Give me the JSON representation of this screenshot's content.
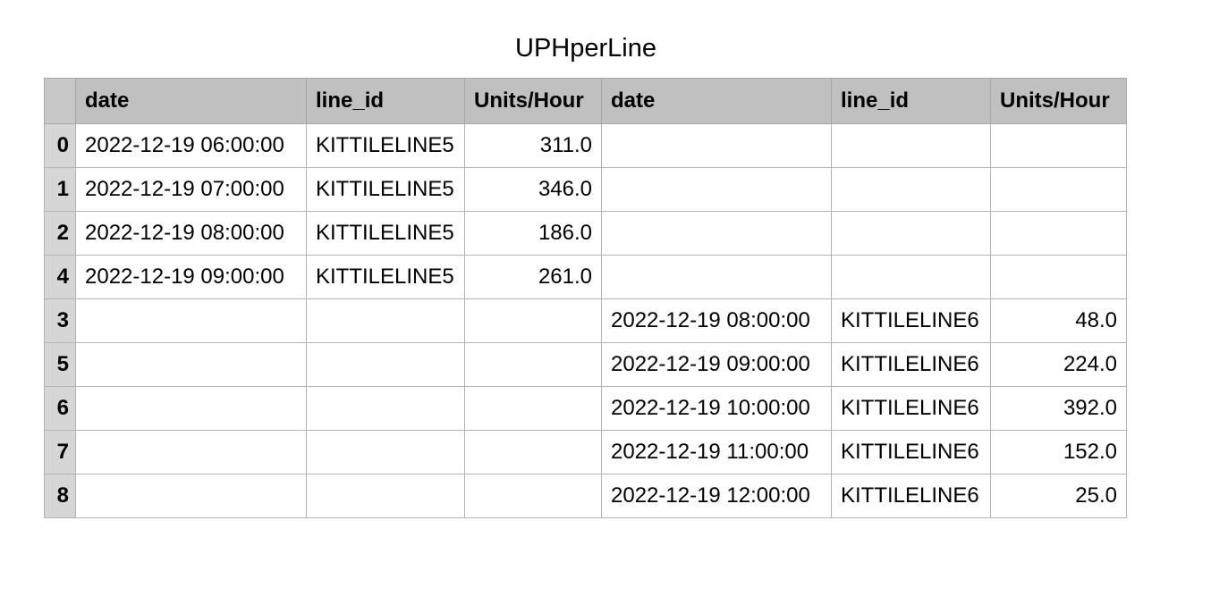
{
  "chart_data": {
    "type": "table",
    "title": "UPHperLine",
    "columns": [
      "",
      "date",
      "line_id",
      "Units/Hour",
      "date",
      "line_id",
      "Units/Hour"
    ],
    "rows": [
      {
        "index": "0",
        "date_1": "2022-12-19 06:00:00",
        "line_id_1": "KITTILELINE5",
        "uph_1": "311.0",
        "date_2": "",
        "line_id_2": "",
        "uph_2": ""
      },
      {
        "index": "1",
        "date_1": "2022-12-19 07:00:00",
        "line_id_1": "KITTILELINE5",
        "uph_1": "346.0",
        "date_2": "",
        "line_id_2": "",
        "uph_2": ""
      },
      {
        "index": "2",
        "date_1": "2022-12-19 08:00:00",
        "line_id_1": "KITTILELINE5",
        "uph_1": "186.0",
        "date_2": "",
        "line_id_2": "",
        "uph_2": ""
      },
      {
        "index": "4",
        "date_1": "2022-12-19 09:00:00",
        "line_id_1": "KITTILELINE5",
        "uph_1": "261.0",
        "date_2": "",
        "line_id_2": "",
        "uph_2": ""
      },
      {
        "index": "3",
        "date_1": "",
        "line_id_1": "",
        "uph_1": "",
        "date_2": "2022-12-19 08:00:00",
        "line_id_2": "KITTILELINE6",
        "uph_2": "48.0"
      },
      {
        "index": "5",
        "date_1": "",
        "line_id_1": "",
        "uph_1": "",
        "date_2": "2022-12-19 09:00:00",
        "line_id_2": "KITTILELINE6",
        "uph_2": "224.0"
      },
      {
        "index": "6",
        "date_1": "",
        "line_id_1": "",
        "uph_1": "",
        "date_2": "2022-12-19 10:00:00",
        "line_id_2": "KITTILELINE6",
        "uph_2": "392.0"
      },
      {
        "index": "7",
        "date_1": "",
        "line_id_1": "",
        "uph_1": "",
        "date_2": "2022-12-19 11:00:00",
        "line_id_2": "KITTILELINE6",
        "uph_2": "152.0"
      },
      {
        "index": "8",
        "date_1": "",
        "line_id_1": "",
        "uph_1": "",
        "date_2": "2022-12-19 12:00:00",
        "line_id_2": "KITTILELINE6",
        "uph_2": "25.0"
      }
    ]
  }
}
